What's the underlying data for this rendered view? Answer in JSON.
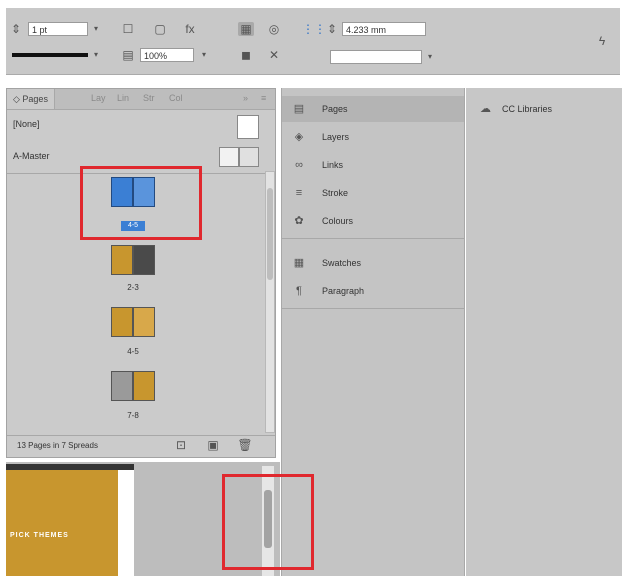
{
  "control_bar": {
    "stroke_weight": "1 pt",
    "zoom": "100%",
    "width_value": "4.233 mm"
  },
  "pages_panel": {
    "tabs": [
      "Pages",
      "Lay",
      "Lin",
      "Str",
      "Col"
    ],
    "none_label": "[None]",
    "master_label": "A-Master",
    "spreads": [
      {
        "label": "4-5",
        "style": "selected"
      },
      {
        "label": "2-3",
        "style": "image"
      },
      {
        "label": "4-5",
        "style": "image"
      },
      {
        "label": "7-8",
        "style": "image"
      }
    ],
    "footer_status": "13 Pages in 7 Spreads"
  },
  "dock": {
    "items": [
      {
        "label": "Pages",
        "icon": "pages-icon"
      },
      {
        "label": "Layers",
        "icon": "layers-icon"
      },
      {
        "label": "Links",
        "icon": "links-icon"
      },
      {
        "label": "Stroke",
        "icon": "stroke-icon"
      },
      {
        "label": "Colours",
        "icon": "colours-icon"
      }
    ],
    "items2": [
      {
        "label": "Swatches",
        "icon": "swatches-icon"
      },
      {
        "label": "Paragraph",
        "icon": "paragraph-icon"
      }
    ]
  },
  "libraries": {
    "label": "CC Libraries"
  },
  "document": {
    "banner_text": "PICK THEMES"
  },
  "colors": {
    "highlight": "#e0282e",
    "page_gold": "#c8962e",
    "selected_blue": "#3b7fd4"
  }
}
